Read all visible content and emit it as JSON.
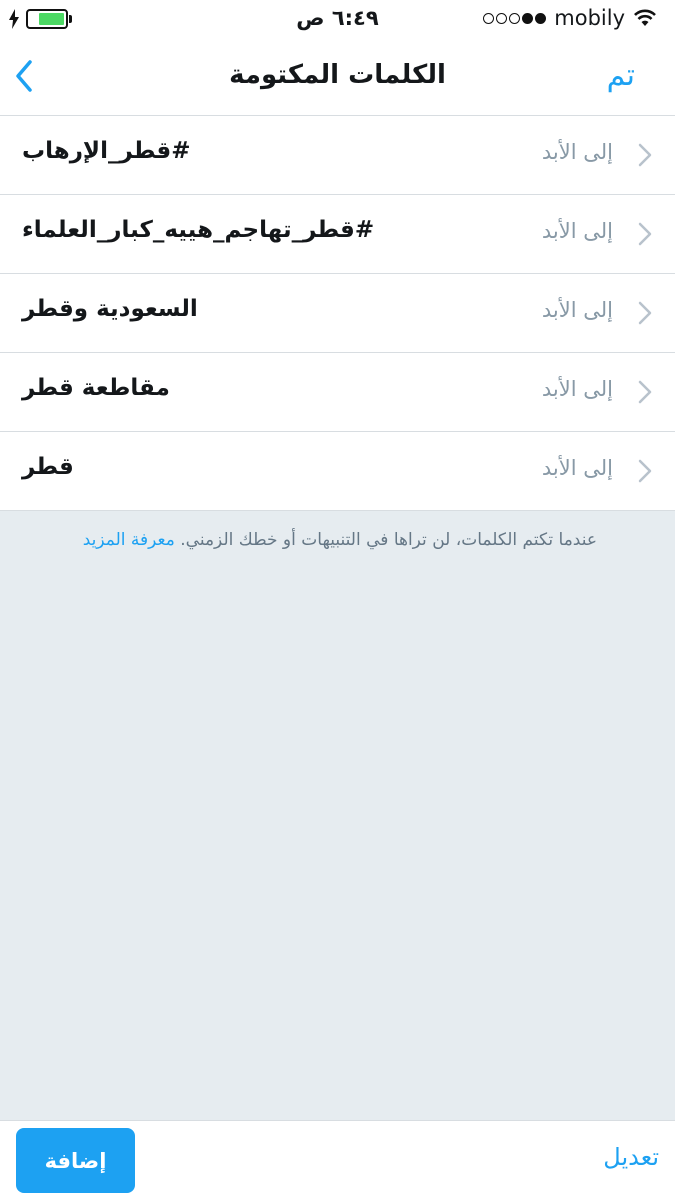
{
  "status_bar": {
    "time": "٦:٤٩ ص",
    "carrier": "mobily",
    "battery_level": 0.75,
    "signal_bars_filled": 2,
    "signal_bars_total": 5
  },
  "nav": {
    "title": "الكلمات المكتومة",
    "done_label": "تم",
    "back_icon": "chevron-left-icon"
  },
  "muted_words": [
    {
      "word": "#قطر_الإرهاب",
      "duration": "إلى الأبد"
    },
    {
      "word": "#قطر_تهاجم_هييه_كبار_العلماء",
      "duration": "إلى الأبد"
    },
    {
      "word": "السعودية وقطر",
      "duration": "إلى الأبد"
    },
    {
      "word": "مقاطعة قطر",
      "duration": "إلى الأبد"
    },
    {
      "word": "قطر",
      "duration": "إلى الأبد"
    }
  ],
  "info": {
    "text": "عندما تكتم الكلمات، لن تراها في التنبيهات أو خطك الزمني.",
    "learn_more": "معرفة المزيد"
  },
  "bottom": {
    "add_label": "إضافة",
    "edit_label": "تعديل"
  },
  "colors": {
    "accent": "#1da1f2",
    "background": "#e6ecf0",
    "secondary_text": "#8899a6"
  }
}
